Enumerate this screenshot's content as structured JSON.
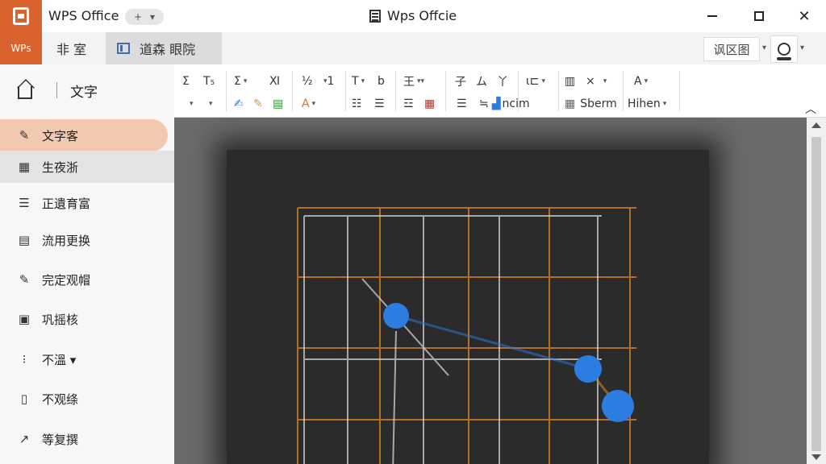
{
  "titlebar": {
    "app_name": "WPS Office",
    "tab_add": "+",
    "tab_menu": "▾",
    "doc_title": "Wps Offcie",
    "min_label": "",
    "max_label": "",
    "close_label": "✕"
  },
  "menubar": {
    "badge": "WPs",
    "tabs": [
      {
        "label": "非 室"
      },
      {
        "label": "道森 眼院"
      }
    ],
    "search_label": "讽区图",
    "drop": "▾",
    "user_drop": "▾"
  },
  "sidebar": {
    "header": "文字",
    "items": [
      {
        "icon": "✎",
        "label": "文字客"
      },
      {
        "icon": "▦",
        "label": "生夜浙"
      },
      {
        "icon": "☰",
        "label": "正遺育富"
      },
      {
        "icon": "▤",
        "label": "流用更换"
      },
      {
        "icon": "✎",
        "label": "完定观帽"
      },
      {
        "icon": "▣",
        "label": "巩摇核"
      },
      {
        "icon": "⁝",
        "label": "不溫 ▾"
      },
      {
        "icon": "▯",
        "label": "不观绦"
      },
      {
        "icon": "↗",
        "label": "等复撰"
      }
    ]
  },
  "ribbon": {
    "row1": [
      "Σ",
      "Т₅",
      "Σ",
      "Ⅺ",
      "½",
      "1",
      "T",
      "b",
      "王",
      "子",
      "ム",
      "丫",
      "ι⊏",
      "▥",
      "×",
      "A"
    ],
    "row2_text": [
      "Sberm",
      "Hihen",
      "ncim"
    ]
  },
  "colors": {
    "accent": "#d9632e",
    "active_item": "#f3c8b0",
    "canvas_bg": "#2b2b2b",
    "grid_orange": "#d4802a",
    "grid_white": "#dddddd",
    "point_blue": "#2b7de0"
  }
}
